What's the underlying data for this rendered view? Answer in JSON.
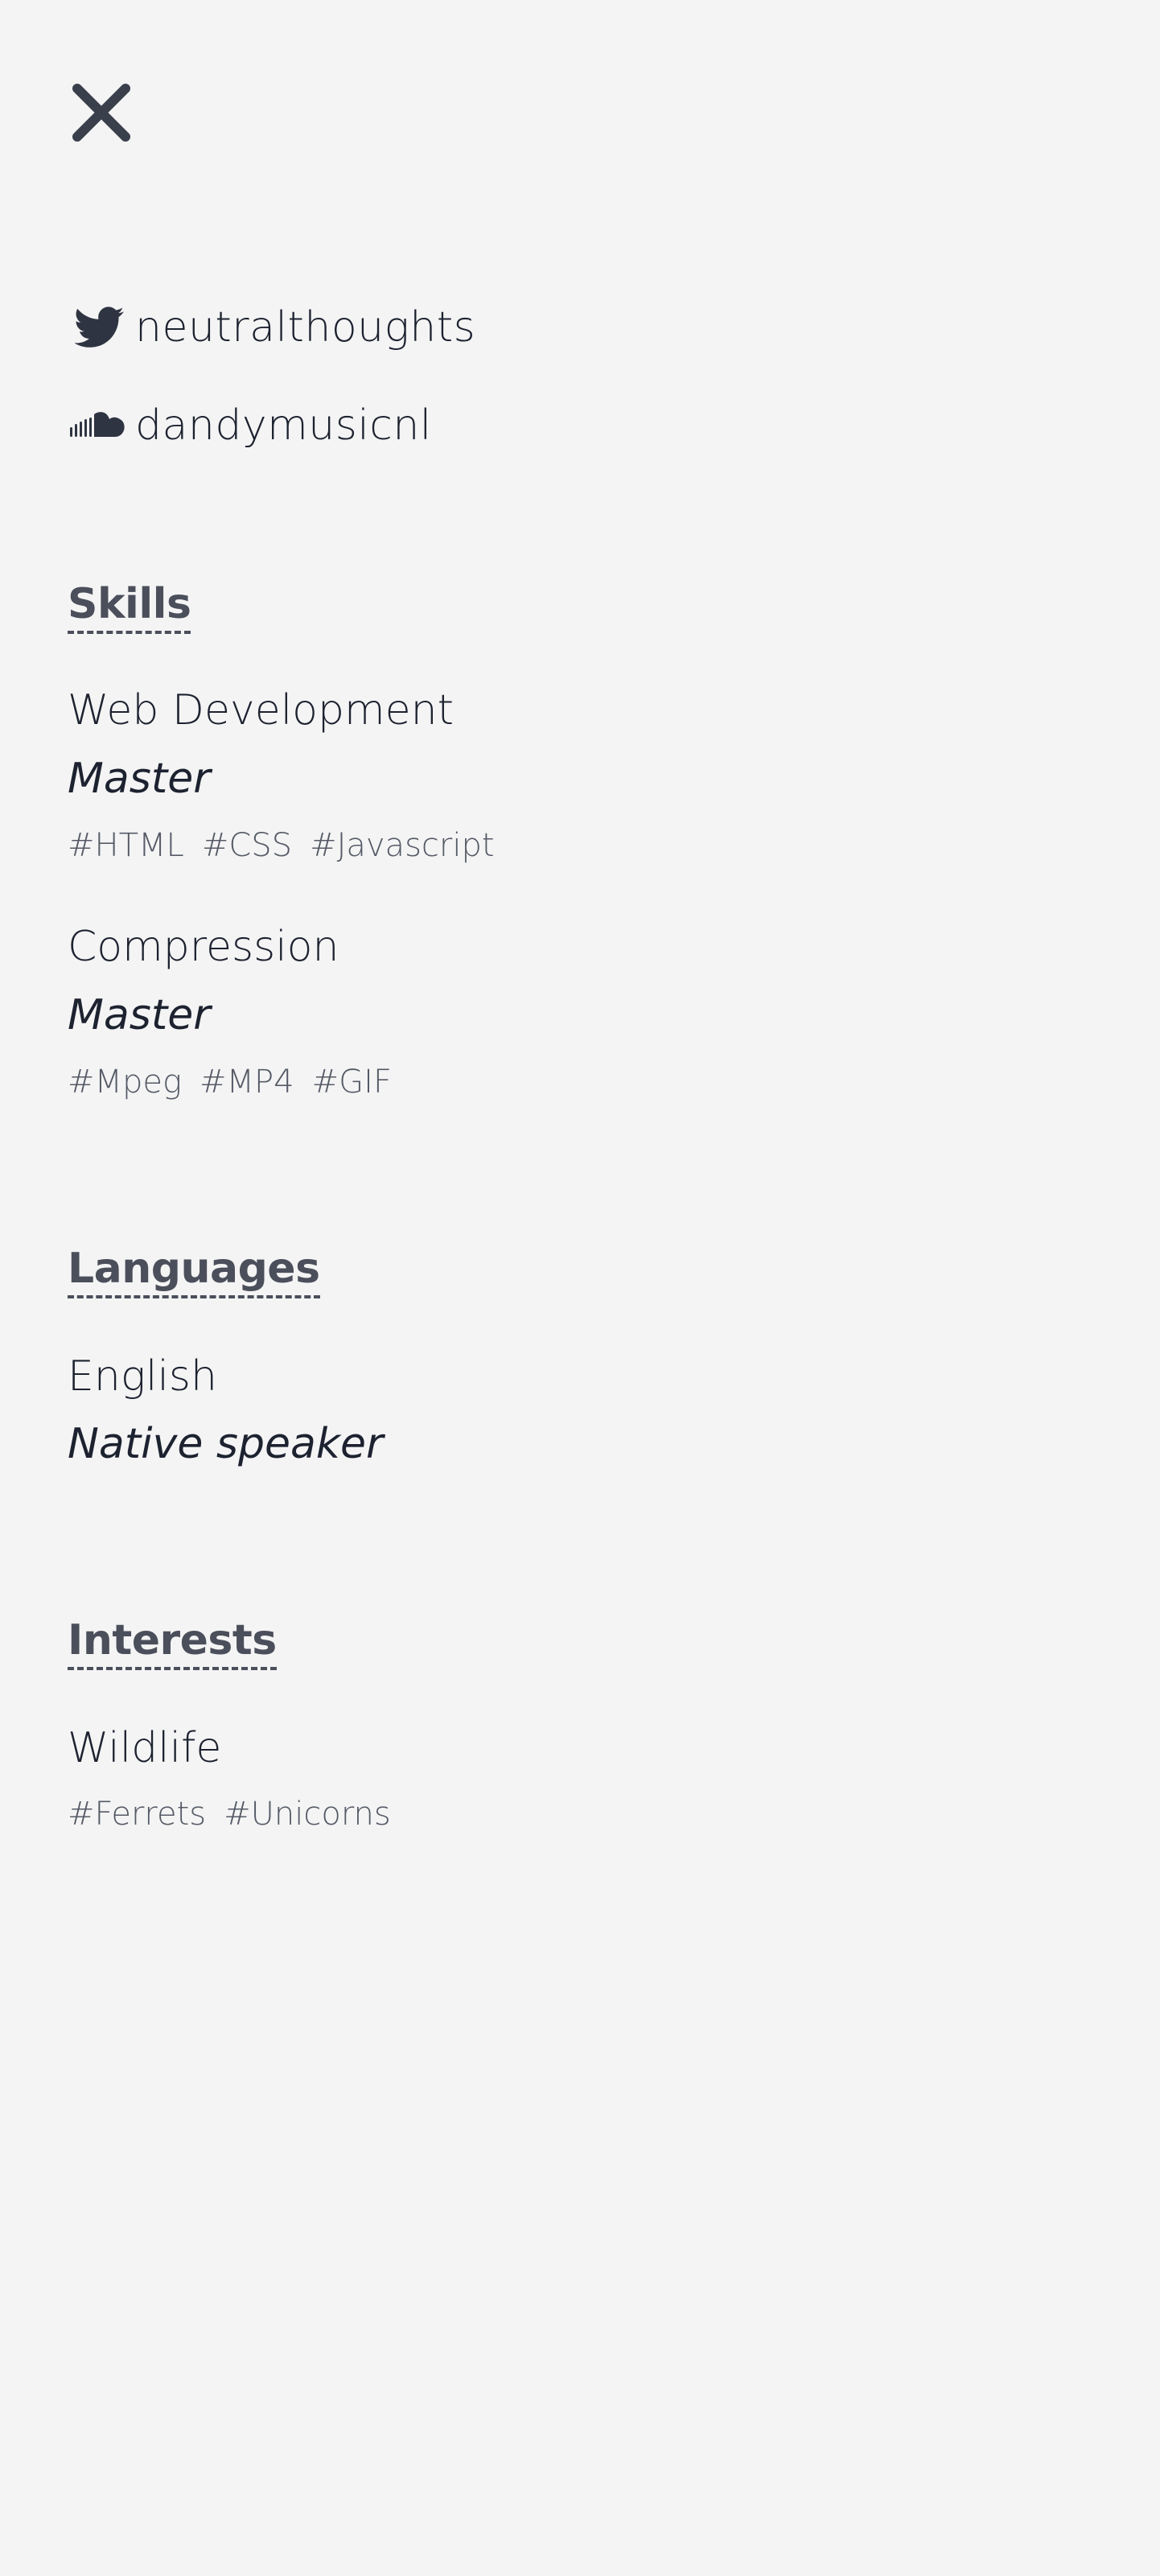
{
  "colors": {
    "background": "#f4f4f4",
    "text": "#1d2230",
    "heading": "#4b4f5b",
    "tag": "#555a66"
  },
  "close": {
    "icon": "close-icon"
  },
  "social": [
    {
      "icon": "twitter-icon",
      "handle": "neutralthoughts"
    },
    {
      "icon": "soundcloud-icon",
      "handle": "dandymusicnl"
    }
  ],
  "skills": {
    "title": "Skills",
    "items": [
      {
        "name": "Web Development",
        "level": "Master",
        "keywords": [
          "#HTML",
          "#CSS",
          "#Javascript"
        ]
      },
      {
        "name": "Compression",
        "level": "Master",
        "keywords": [
          "#Mpeg",
          "#MP4",
          "#GIF"
        ]
      }
    ]
  },
  "languages": {
    "title": "Languages",
    "items": [
      {
        "name": "English",
        "level": "Native speaker"
      }
    ]
  },
  "interests": {
    "title": "Interests",
    "items": [
      {
        "name": "Wildlife",
        "keywords": [
          "#Ferrets",
          "#Unicorns"
        ]
      }
    ]
  }
}
